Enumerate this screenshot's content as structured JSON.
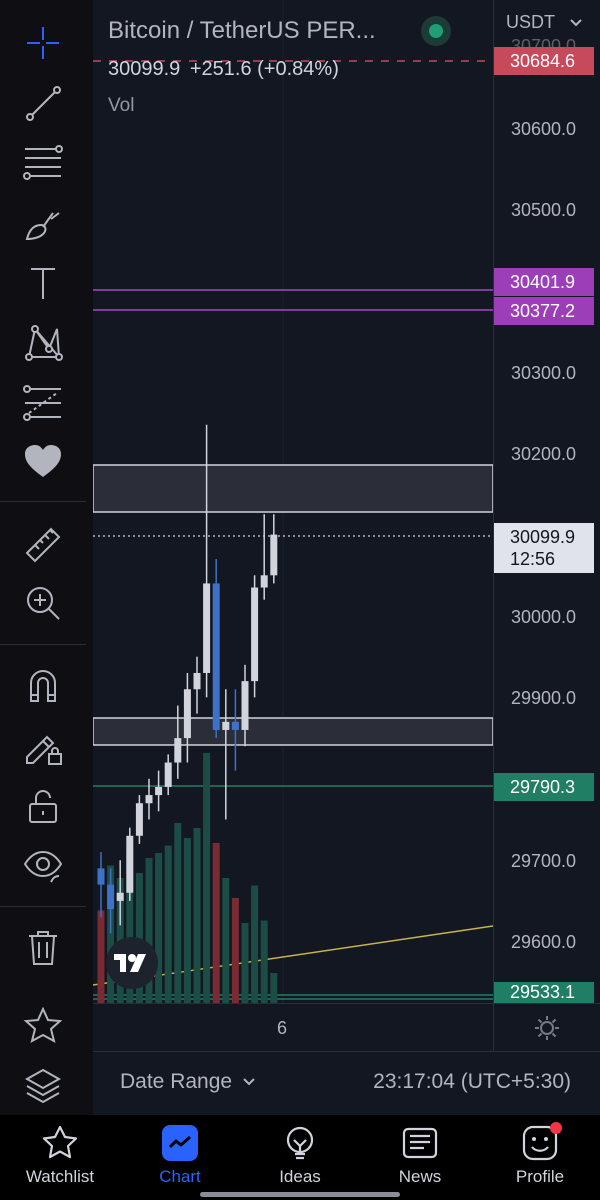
{
  "header": {
    "symbol": "Bitcoin / TetherUS PER...",
    "currency": "USDT",
    "last_price": "30099.9",
    "change": "+251.6 (+0.84%)",
    "volume_label": "Vol"
  },
  "price_axis": {
    "ticks": [
      "30600.0",
      "30500.0",
      "30300.0",
      "30200.0",
      "30000.0",
      "29900.0",
      "29700.0",
      "29600.0"
    ],
    "partial_top": "30700.0"
  },
  "price_badges": {
    "alert_red": "30684.6",
    "purple_1": "30401.9",
    "purple_2": "30377.2",
    "current_price": "30099.9",
    "countdown": "12:56",
    "green_1": "29790.3",
    "green_2": "29533.1"
  },
  "time_axis": {
    "label": "6"
  },
  "bottom_bar": {
    "date_range_label": "Date Range",
    "clock": "23:17:04 (UTC+5:30)"
  },
  "tabs": [
    {
      "label": "Watchlist",
      "icon": "star-icon",
      "active": false
    },
    {
      "label": "Chart",
      "icon": "chart-icon",
      "active": true
    },
    {
      "label": "Ideas",
      "icon": "lightbulb-icon",
      "active": false
    },
    {
      "label": "News",
      "icon": "news-icon",
      "active": false
    },
    {
      "label": "Profile",
      "icon": "profile-icon",
      "active": false
    }
  ],
  "sidebar_tools": [
    "crosshair-icon",
    "trend-line-icon",
    "fib-levels-icon",
    "brush-icon",
    "text-icon",
    "pattern-icon",
    "prediction-icon",
    "favorites-heart-icon",
    "ruler-icon",
    "zoom-in-icon",
    "magnet-icon",
    "lock-drawing-icon",
    "unlock-icon",
    "eye-icon",
    "trash-icon",
    "star-icon",
    "layers-icon"
  ],
  "colors": {
    "background": "#131722",
    "up_candle": "#d1d4dc",
    "down_candle": "#3d72c6",
    "purple": "#a04bbd",
    "green": "#1f7e64",
    "red_alert": "#c74a5b",
    "accent": "#2962ff",
    "notification": "#f23645",
    "zone_fill": "#2b2e38"
  },
  "chart_data": {
    "type": "candlestick",
    "price_range": [
      29500,
      30720
    ],
    "candles": [
      {
        "o": 29690,
        "h": 29710,
        "l": 29630,
        "c": 29670
      },
      {
        "o": 29670,
        "h": 29690,
        "l": 29610,
        "c": 29640
      },
      {
        "o": 29650,
        "h": 29700,
        "l": 29620,
        "c": 29660
      },
      {
        "o": 29660,
        "h": 29740,
        "l": 29650,
        "c": 29730
      },
      {
        "o": 29730,
        "h": 29780,
        "l": 29720,
        "c": 29770
      },
      {
        "o": 29770,
        "h": 29800,
        "l": 29750,
        "c": 29780
      },
      {
        "o": 29780,
        "h": 29810,
        "l": 29760,
        "c": 29790
      },
      {
        "o": 29790,
        "h": 29830,
        "l": 29780,
        "c": 29820
      },
      {
        "o": 29820,
        "h": 29890,
        "l": 29800,
        "c": 29850
      },
      {
        "o": 29850,
        "h": 29930,
        "l": 29820,
        "c": 29910
      },
      {
        "o": 29910,
        "h": 29950,
        "l": 29880,
        "c": 29930
      },
      {
        "o": 29930,
        "h": 30235,
        "l": 29900,
        "c": 30040
      },
      {
        "o": 30040,
        "h": 30070,
        "l": 29850,
        "c": 29860
      },
      {
        "o": 29860,
        "h": 29910,
        "l": 29750,
        "c": 29870
      },
      {
        "o": 29870,
        "h": 29910,
        "l": 29810,
        "c": 29860
      },
      {
        "o": 29860,
        "h": 29940,
        "l": 29840,
        "c": 29920
      },
      {
        "o": 29920,
        "h": 30050,
        "l": 29900,
        "c": 30035
      },
      {
        "o": 30035,
        "h": 30125,
        "l": 30020,
        "c": 30050
      },
      {
        "o": 30050,
        "h": 30125,
        "l": 30040,
        "c": 30100
      }
    ],
    "volumes": [
      {
        "v": 0.37,
        "up": false
      },
      {
        "v": 0.55,
        "up": true
      },
      {
        "v": 0.5,
        "up": true
      },
      {
        "v": 0.6,
        "up": true
      },
      {
        "v": 0.52,
        "up": true
      },
      {
        "v": 0.58,
        "up": true
      },
      {
        "v": 0.6,
        "up": true
      },
      {
        "v": 0.63,
        "up": true
      },
      {
        "v": 0.72,
        "up": true
      },
      {
        "v": 0.66,
        "up": true
      },
      {
        "v": 0.7,
        "up": true
      },
      {
        "v": 1.0,
        "up": true
      },
      {
        "v": 0.64,
        "up": false
      },
      {
        "v": 0.5,
        "up": true
      },
      {
        "v": 0.42,
        "up": false
      },
      {
        "v": 0.32,
        "up": true
      },
      {
        "v": 0.47,
        "up": true
      },
      {
        "v": 0.33,
        "up": true
      },
      {
        "v": 0.12,
        "up": true
      }
    ]
  }
}
